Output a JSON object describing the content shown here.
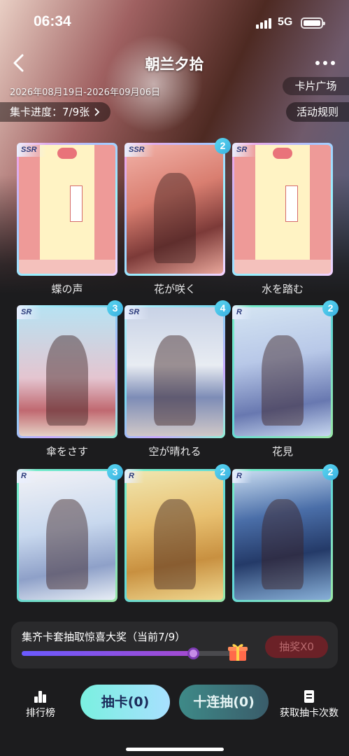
{
  "status_bar": {
    "time": "06:34",
    "network": "5G"
  },
  "nav": {
    "title": "朝兰夕拾",
    "back_icon": "chevron-left-icon",
    "more_icon": "more-dots-icon"
  },
  "event": {
    "date_range": "2026年08月19日-2026年09月06日",
    "card_square_label": "卡片广场",
    "collection_progress": "集卡进度：7/9张",
    "rules_label": "活动规则"
  },
  "cards": [
    {
      "rarity": "SSR",
      "name": "蝶の声",
      "count": "",
      "art": "envelope"
    },
    {
      "rarity": "SSR",
      "name": "花が咲く",
      "count": "2",
      "art": "warm"
    },
    {
      "rarity": "SR",
      "name": "水を踏む",
      "count": "",
      "art": "envelope"
    },
    {
      "rarity": "SR",
      "name": "傘をさす",
      "count": "3",
      "art": "street"
    },
    {
      "rarity": "SR",
      "name": "空が晴れる",
      "count": "4",
      "art": "indoor"
    },
    {
      "rarity": "R",
      "name": "花見",
      "count": "2",
      "art": "blue"
    },
    {
      "rarity": "R",
      "name": "",
      "count": "3",
      "art": "white"
    },
    {
      "rarity": "R",
      "name": "",
      "count": "2",
      "art": "gold"
    },
    {
      "rarity": "R",
      "name": "",
      "count": "2",
      "art": "night"
    }
  ],
  "reward": {
    "title": "集齐卡套抽取惊喜大奖（当前7/9）",
    "progress_fraction": 0.7778,
    "draw_prize_label": "抽奖X0",
    "gift_icon": "gift-icon",
    "colors": {
      "progress_start": "#6a5aff",
      "progress_end": "#a44ad0",
      "disabled_button": "#6b2127"
    }
  },
  "bottom": {
    "leaderboard_label": "排行榜",
    "draw_one_label": "抽卡(0)",
    "draw_ten_label": "十连抽(0)",
    "get_draws_label": "获取抽卡次数"
  }
}
